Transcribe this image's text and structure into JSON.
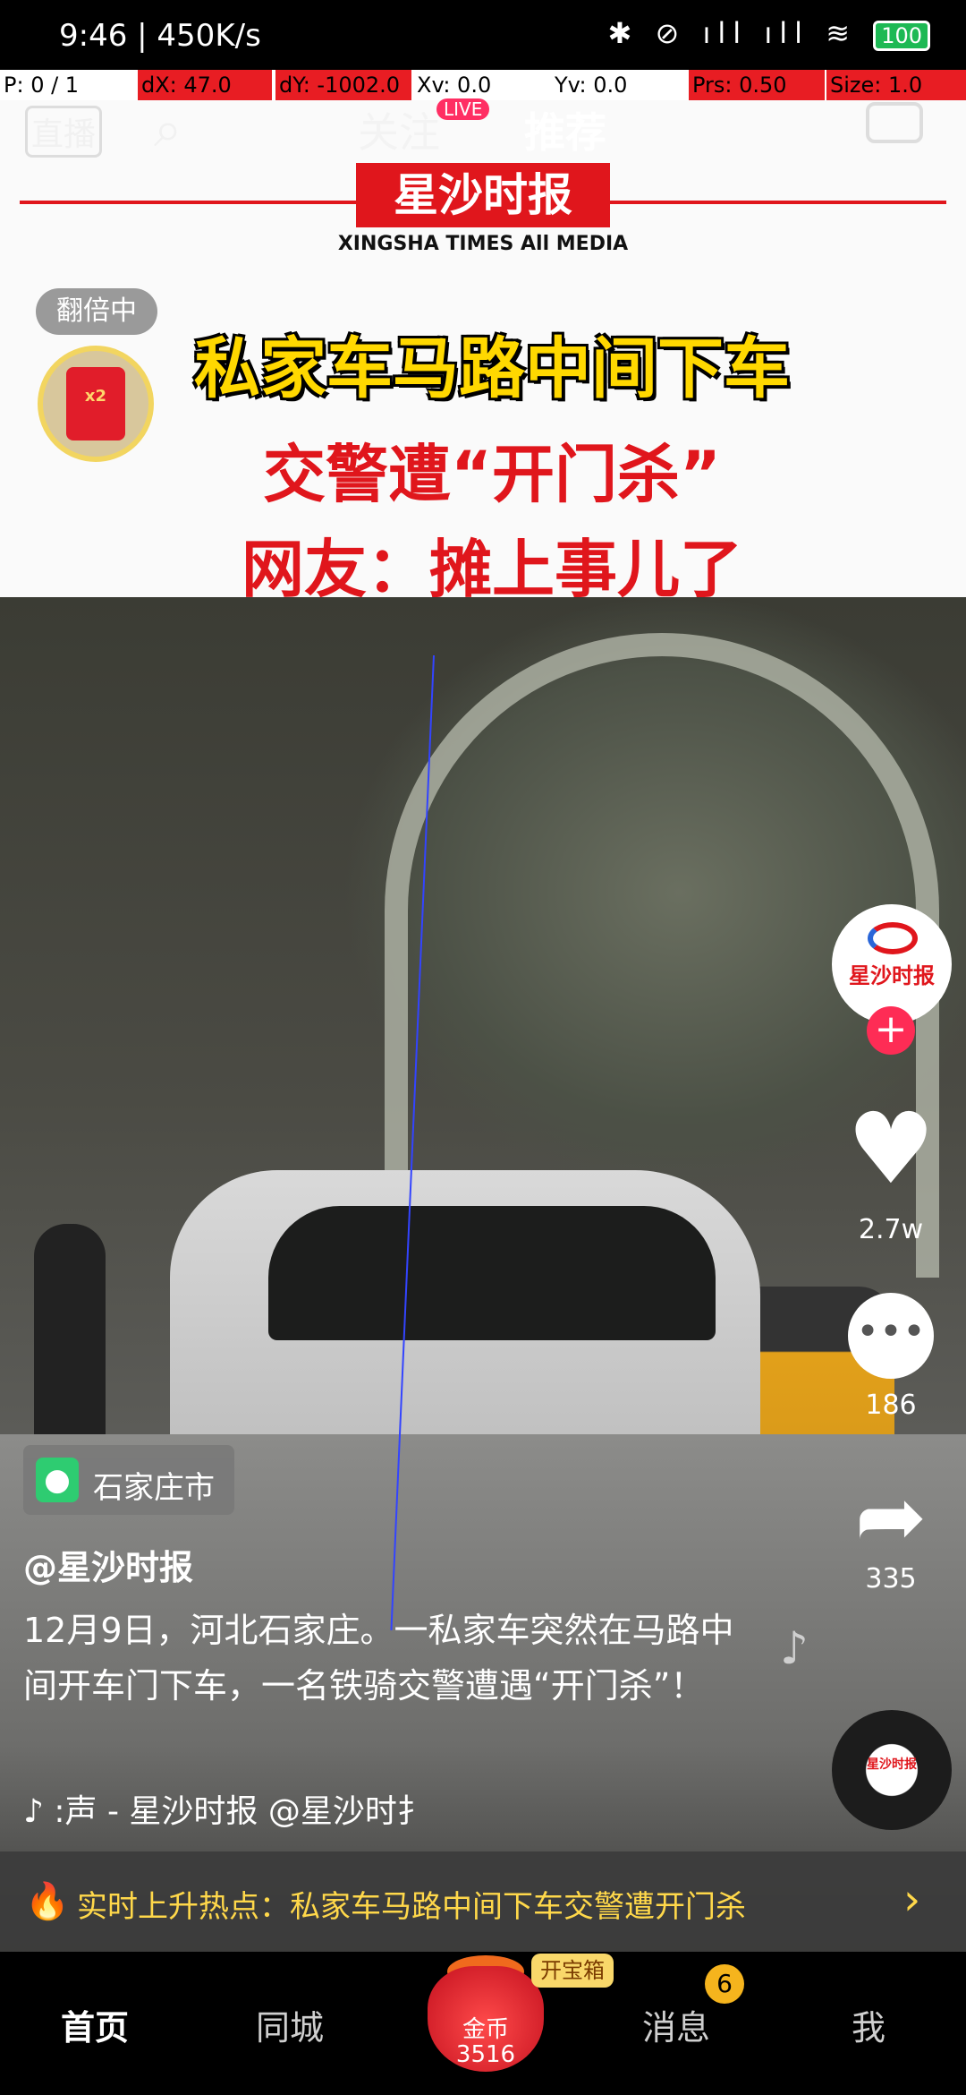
{
  "status_bar": {
    "time": "9:46 | 450K/s",
    "icons_text": "✱ ⊘ ıll ıll ≋",
    "battery": "100"
  },
  "debug_overlay": {
    "p": "P: 0 / 1",
    "dx": "dX: 47.0",
    "dy": "dY: -1002.0",
    "xv": "Xv: 0.0",
    "yv": "Yv: 0.0",
    "prs": "Prs: 0.50",
    "size": "Size: 1.0"
  },
  "top_nav": {
    "live": "直播",
    "following": "关注",
    "live_badge": "LIVE",
    "recommend": "推荐"
  },
  "banner": {
    "logo": "星沙时报",
    "logo_sub": "XINGSHA TIMES All MEDIA",
    "headline1": "私家车马路中间下车",
    "headline2": "交警遭“开门杀”",
    "headline3": "网友：摊上事儿了"
  },
  "reward": {
    "double_badge": "翻倍中",
    "envelope_multiplier": "x2"
  },
  "actions": {
    "avatar_name": "星沙时报",
    "follow": "+",
    "likes": "2.7w",
    "comments": "186",
    "shares": "335"
  },
  "info": {
    "location": "石家庄市",
    "author": "@星沙时报",
    "caption": "12月9日，河北石家庄。一私家车突然在马路中间开车门下车，一名铁骑交警遭遇“开门杀”！",
    "music": "♪ :声 - 星沙时报    @星沙时扌"
  },
  "hot_bar": {
    "text": "实时上升热点：私家车马路中间下车交警遭开门杀",
    "chevron": "›"
  },
  "bottom_nav": {
    "home": "首页",
    "city": "同城",
    "coin_label": "金币",
    "coin_count": "3516",
    "chest": "开宝箱",
    "messages": "消息",
    "messages_badge": "6",
    "me": "我"
  },
  "colors": {
    "brand_red": "#e0161c",
    "headline_yellow": "#ffd800",
    "follow_pink": "#fe2c55",
    "hot_yellow": "#ffd84a"
  }
}
